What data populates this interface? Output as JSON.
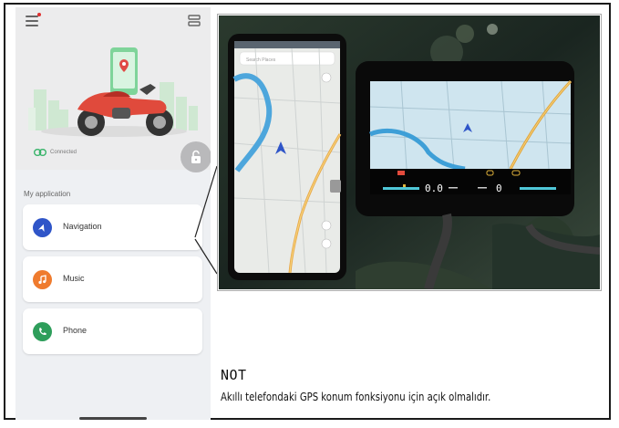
{
  "app": {
    "status": {
      "connection_label": "Connected"
    },
    "section_title": "My application",
    "applications": [
      {
        "label": "Navigation",
        "icon": "navigation-icon",
        "color": "#2f55c8"
      },
      {
        "label": "Music",
        "icon": "music-icon",
        "color": "#ef7b2e"
      },
      {
        "label": "Phone",
        "icon": "phone-icon",
        "color": "#2e9e5b"
      }
    ]
  },
  "photo": {
    "phone_map_search_placeholder": "Search Places",
    "dashboard": {
      "left_speed_value": "0.0",
      "right_value": "0"
    }
  },
  "note": {
    "title": "NOT",
    "text": "Akıllı telefondaki GPS konum fonksiyonu için açık olmalıdır."
  },
  "colors": {
    "accent_blue": "#2f55c8",
    "music_orange": "#ef7b2e",
    "phone_green": "#2e9e5b",
    "connected_green": "#38b46a"
  }
}
